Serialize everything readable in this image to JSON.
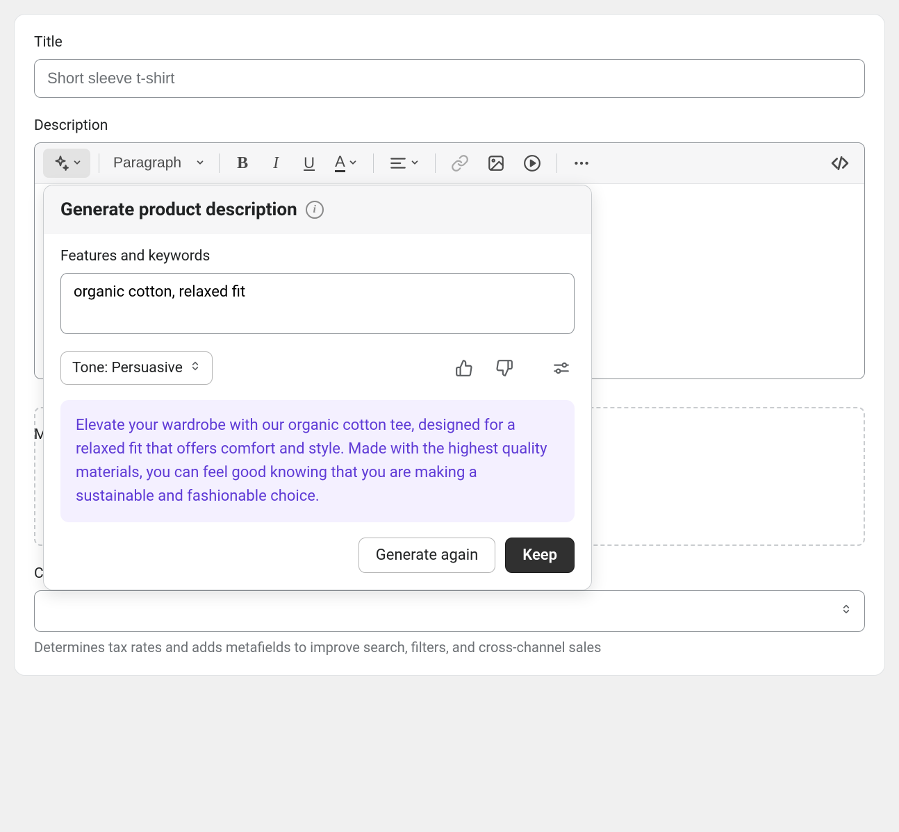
{
  "title": {
    "label": "Title",
    "placeholder": "Short sleeve t-shirt"
  },
  "description": {
    "label": "Description",
    "paragraph_label": "Paragraph"
  },
  "ai_popover": {
    "title": "Generate product description",
    "features_label": "Features and keywords",
    "features_value": "organic cotton, relaxed fit",
    "tone_label": "Tone: Persuasive",
    "generated_text": "Elevate your wardrobe with our organic cotton tee, designed for a relaxed fit that offers comfort and style. Made with the highest quality materials, you can feel good knowing that you are making a sustainable and fashionable choice.",
    "generate_again_label": "Generate again",
    "keep_label": "Keep"
  },
  "media": {
    "label_partial": "M"
  },
  "category": {
    "label": "Category",
    "hint": "Determines tax rates and adds metafields to improve search, filters, and cross-channel sales"
  }
}
